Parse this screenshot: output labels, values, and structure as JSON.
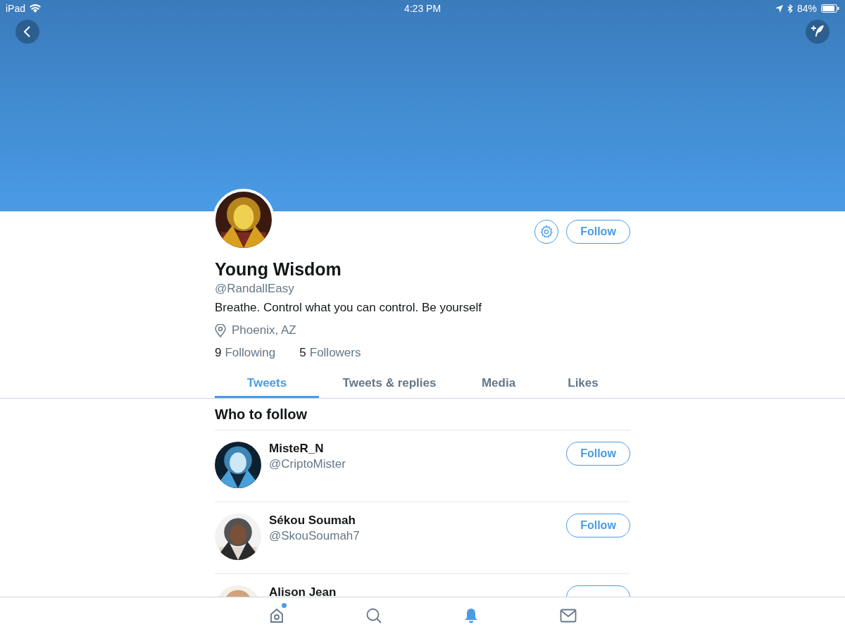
{
  "status_bar": {
    "device": "iPad",
    "time": "4:23 PM",
    "battery": "84%"
  },
  "profile": {
    "name": "Young Wisdom",
    "handle": "@RandallEasy",
    "bio": "Breathe. Control what you can control. Be yourself",
    "location": "Phoenix, AZ",
    "following_count": "9",
    "following_label": "Following",
    "followers_count": "5",
    "followers_label": "Followers",
    "follow_button": "Follow"
  },
  "tabs": [
    {
      "label": "Tweets",
      "selected": true
    },
    {
      "label": "Tweets & replies",
      "selected": false
    },
    {
      "label": "Media",
      "selected": false
    },
    {
      "label": "Likes",
      "selected": false
    }
  ],
  "who_to_follow": {
    "title": "Who to follow",
    "accounts": [
      {
        "name": "MisteR_N",
        "handle": "@CriptoMister",
        "button": "Follow"
      },
      {
        "name": "Sékou Soumah",
        "handle": "@SkouSoumah7",
        "button": "Follow"
      },
      {
        "name": "Alison Jean"
      }
    ]
  },
  "bottom_nav": [
    {
      "kind": "home",
      "selected": false,
      "badge": true
    },
    {
      "kind": "search",
      "selected": false,
      "badge": false
    },
    {
      "kind": "notifications",
      "selected": true,
      "badge": false
    },
    {
      "kind": "messages",
      "selected": false,
      "badge": false
    }
  ]
}
